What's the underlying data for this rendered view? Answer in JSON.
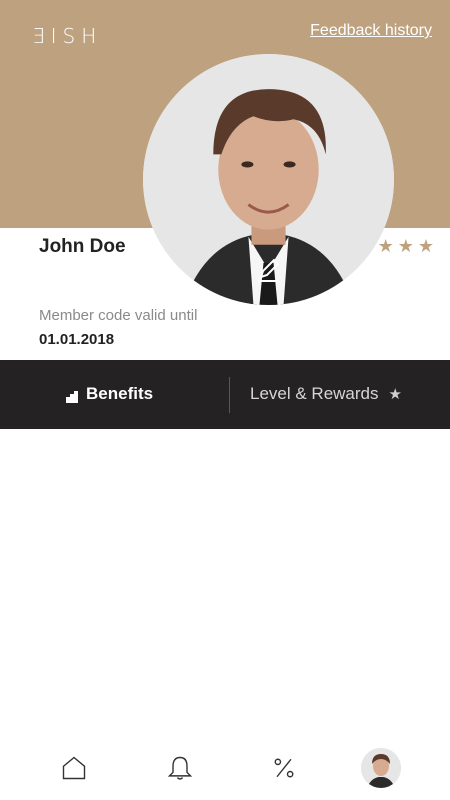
{
  "header": {
    "brand": "ƎISH",
    "feedback_link": "Feedback history"
  },
  "profile": {
    "name": "John Doe",
    "stars": "★★★",
    "member_code_label": "Member code valid until",
    "member_code_date": "01.01.2018"
  },
  "tabs": {
    "benefits_label": "Benefits",
    "rewards_label": "Level & Rewards",
    "rewards_icon": "★"
  },
  "colors": {
    "accent": "#bea27f",
    "tabbar": "#242222"
  },
  "icons": {
    "edit": "edit-icon",
    "home": "home-icon",
    "bell": "bell-icon",
    "percent": "percent-icon"
  }
}
